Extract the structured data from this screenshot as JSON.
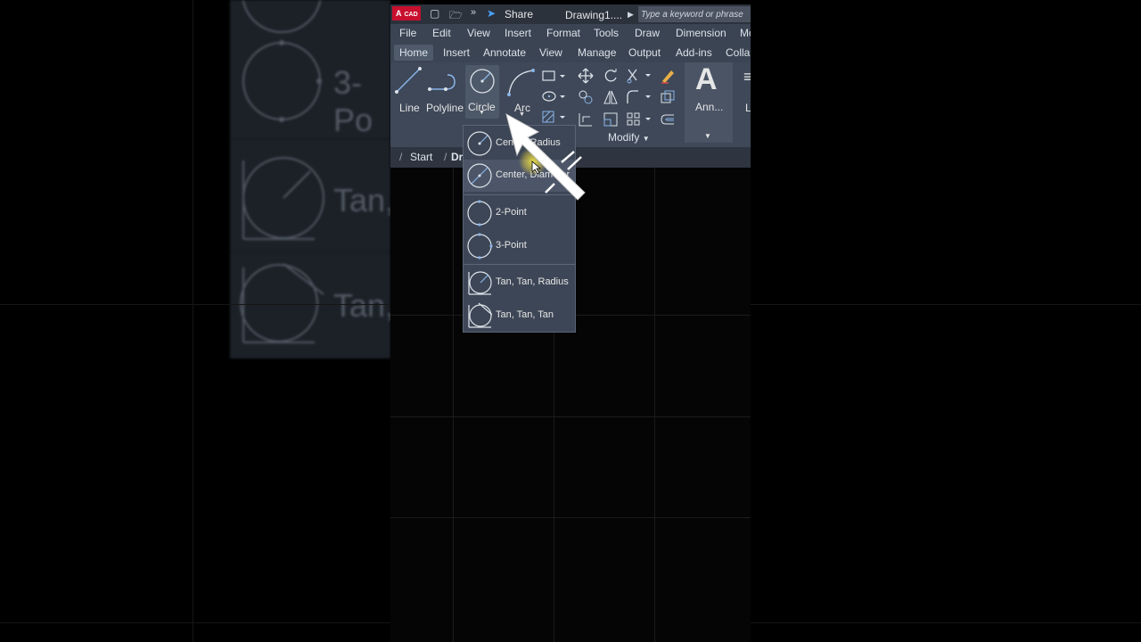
{
  "titlebar": {
    "logo_text": "A",
    "logo_sub": "CAD",
    "share_label": "Share",
    "document_title": "Drawing1....",
    "search_placeholder": "Type a keyword or phrase"
  },
  "menubar": {
    "items": [
      "File",
      "Edit",
      "View",
      "Insert",
      "Format",
      "Tools",
      "Draw",
      "Dimension",
      "Mo"
    ]
  },
  "ribbon_tabs": {
    "items": [
      "Home",
      "Insert",
      "Annotate",
      "View",
      "Manage",
      "Output",
      "Add-ins",
      "Collab"
    ],
    "active": "Home"
  },
  "ribbon": {
    "line_label": "Line",
    "polyline_label": "Polyline",
    "circle_label": "Circle",
    "arc_label": "Arc",
    "annotation_label": "Ann...",
    "layers_label": "L",
    "modify_panel_label": "Modify"
  },
  "file_tabs": {
    "start_label": "Start",
    "drawing_label": "Dr"
  },
  "circle_menu": {
    "items": [
      {
        "label": "Center, Radius"
      },
      {
        "label": "Center, Diameter"
      },
      {
        "label": "2-Point"
      },
      {
        "label": "3-Point"
      },
      {
        "label": "Tan, Tan, Radius"
      },
      {
        "label": "Tan, Tan, Tan"
      }
    ]
  },
  "background_zoom": {
    "label_3p": "3-Po",
    "label_tan1": "Tan,",
    "label_tan2": "Tan,"
  },
  "colors": {
    "brand_red": "#c8102e",
    "ribbon_bg": "#3e4858",
    "cursor_highlight": "#ffe84a"
  }
}
